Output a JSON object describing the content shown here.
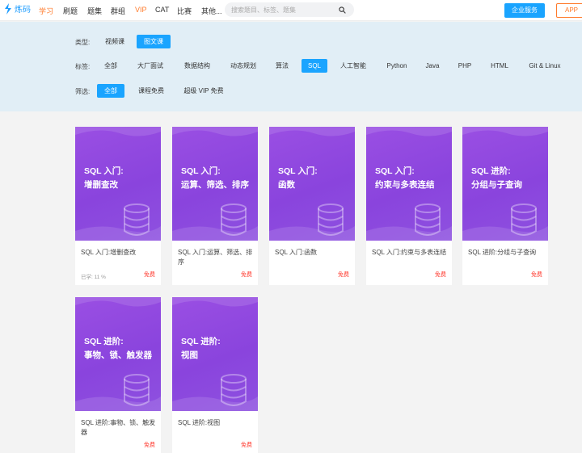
{
  "nav": {
    "logo_text": "炼码",
    "items": [
      "学习",
      "刷题",
      "题集",
      "群组",
      "VIP",
      "CAT",
      "比赛",
      "其他..."
    ],
    "search_placeholder": "搜索题目、标签、题集",
    "enterprise_label": "企业服务",
    "app_label": "APP"
  },
  "filters": {
    "type_label": "类型:",
    "types": [
      "视频课",
      "图文课"
    ],
    "tag_label": "标签:",
    "tags": [
      "全部",
      "大厂面试",
      "数据结构",
      "动态规划",
      "算法",
      "SQL",
      "人工智能",
      "Python",
      "Java",
      "PHP",
      "HTML",
      "Git & Linux"
    ],
    "screen_label": "筛选:",
    "screens": [
      "全部",
      "课程免费",
      "超级 VIP 免费"
    ]
  },
  "cards": [
    {
      "cover_line1": "SQL 入门:",
      "cover_line2": "增删查改",
      "title": "SQL 入门:增删查改",
      "progress": "已学: 11 %",
      "price": "免费"
    },
    {
      "cover_line1": "SQL 入门:",
      "cover_line2": "运算、筛选、排序",
      "title": "SQL 入门:运算、筛选、排序",
      "progress": "",
      "price": "免费"
    },
    {
      "cover_line1": "SQL 入门:",
      "cover_line2": "函数",
      "title": "SQL 入门:函数",
      "progress": "",
      "price": "免费"
    },
    {
      "cover_line1": "SQL 入门:",
      "cover_line2": "约束与多表连结",
      "title": "SQL 入门:约束与多表连结",
      "progress": "",
      "price": "免费"
    },
    {
      "cover_line1": "SQL 进阶:",
      "cover_line2": "分组与子查询",
      "title": "SQL 进阶:分组与子查询",
      "progress": "",
      "price": "免费"
    },
    {
      "cover_line1": "SQL 进阶:",
      "cover_line2": "事物、锁、触发器",
      "title": "SQL 进阶:事物、锁、触发器",
      "progress": "",
      "price": "免费"
    },
    {
      "cover_line1": "SQL 进阶:",
      "cover_line2": "视图",
      "title": "SQL 进阶:视图",
      "progress": "",
      "price": "免费"
    }
  ],
  "colors": {
    "accent": "#1aa4ff",
    "brand": "#ff7b2c",
    "card_purple": "#8a44dd",
    "free_red": "#ff3b30"
  }
}
